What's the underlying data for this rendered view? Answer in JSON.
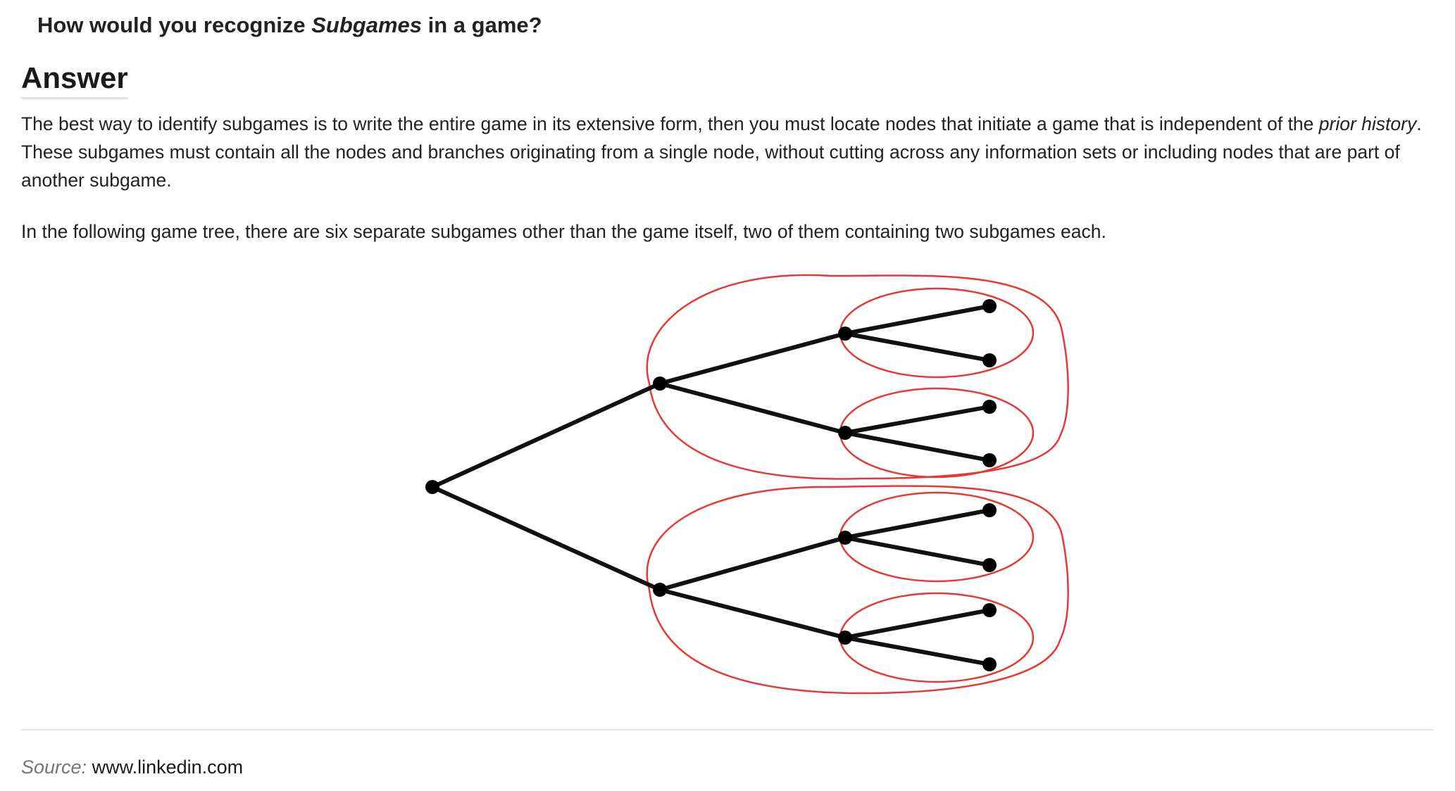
{
  "question": {
    "prefix": "How would you recognize ",
    "emphasis": "Subgames",
    "suffix": " in a game?"
  },
  "answer": {
    "heading": "Answer",
    "paragraph1": {
      "part1": "The best way to identify subgames is to write the entire game in its extensive form, then you must locate nodes that initiate a game that is independent of the ",
      "emphasis": "prior history",
      "part2": ". These subgames must contain all the nodes and branches originating from a single node, without cutting across any information sets or including nodes that are part of another subgame."
    },
    "paragraph2": "In the following game tree, there are six separate subgames other than the game itself, two of them containing two subgames each."
  },
  "figure": {
    "node_color": "#000000",
    "subgame_outline_color": "#e53935"
  },
  "source": {
    "label": "Source:",
    "value": "www.linkedin.com"
  }
}
